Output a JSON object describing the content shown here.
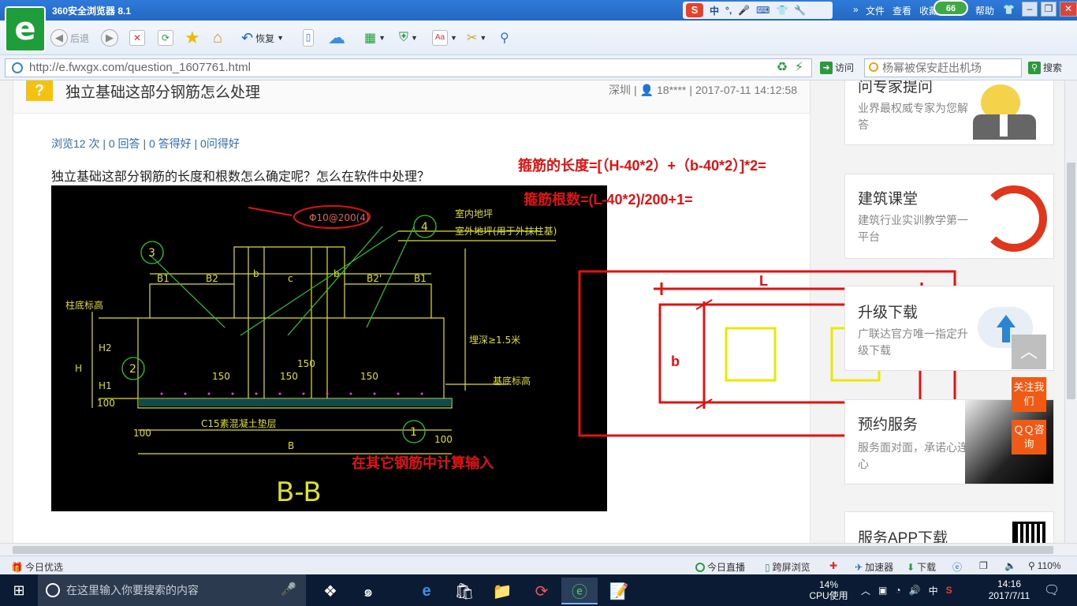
{
  "browser": {
    "title": "360安全浏览器 8.1",
    "menus": [
      "文件",
      "查看",
      "收藏",
      "帮助"
    ],
    "badge": "66",
    "ime": {
      "label": "中",
      "symbols": "°,"
    }
  },
  "toolbar": {
    "back": "后退",
    "restore": "恢复"
  },
  "address": {
    "url": "http://e.fwxgx.com/question_1607761.html",
    "visit": "访问",
    "search_value": "杨幂被保安赶出机场",
    "search": "搜索"
  },
  "question": {
    "icon": "?",
    "title": "独立基础这部分钢筋怎么处理",
    "location": "深圳",
    "user": "18****",
    "datetime": "2017-07-11 14:12:58",
    "stats": "浏览12 次 | 0 回答 | 0 答得好 | 0问得好",
    "body": "独立基础这部分钢筋的长度和根数怎么确定呢？怎么在软件中处理？"
  },
  "annotations": {
    "length_formula": "箍筋的长度=[（H-40*2）+（b-40*2）]*2=",
    "count_formula": "箍筋根数=(L-40*2)/200+1=",
    "other_input": "在其它钢筋中计算输入",
    "dim_L": "L",
    "dim_b": "b"
  },
  "cad": {
    "rebar_callout": "Φ10@200(4)",
    "section": "B-B",
    "labels": {
      "indoor": "室内地坪",
      "outdoor": "室外地坪(用于外抹柱基)",
      "column_base": "柱底标高",
      "base_elev": "基底标高",
      "bury_depth": "埋深≥1.5米",
      "cushion": "C15素混凝土垫层",
      "B1": "B1",
      "B2": "B2",
      "b": "b",
      "c": "c",
      "B2p": "B2'",
      "B": "B",
      "H": "H",
      "H1": "H1",
      "H2": "H2",
      "h100": "100",
      "d100a": "100",
      "d100b": "100",
      "d150": "150",
      "n1": "1",
      "n2": "2",
      "n3": "3",
      "n4": "4"
    }
  },
  "sidebar": {
    "cards": [
      {
        "title": "问专家提问",
        "sub": "业界最权威专家为您解答"
      },
      {
        "title": "建筑课堂",
        "sub": "建筑行业实训教学第一平台"
      },
      {
        "title": "升级下载",
        "sub": "广联达官方唯一指定升级下载"
      },
      {
        "title": "预约服务",
        "sub": "服务面对面，承诺心连心"
      },
      {
        "title": "服务APP下载",
        "sub": ""
      }
    ],
    "follow": "关注我们",
    "qq": "ＱＱ咨询"
  },
  "statusbar": {
    "left": "今日优选",
    "live": "今日直播",
    "cross": "跨屏浏览",
    "accel": "加速器",
    "download": "下载",
    "zoom": "110%"
  },
  "taskbar": {
    "search_placeholder": "在这里输入你要搜索的内容",
    "cpu_percent": "14%",
    "cpu_label": "CPU使用",
    "ime": "中",
    "time": "14:16",
    "date": "2017/7/11"
  }
}
